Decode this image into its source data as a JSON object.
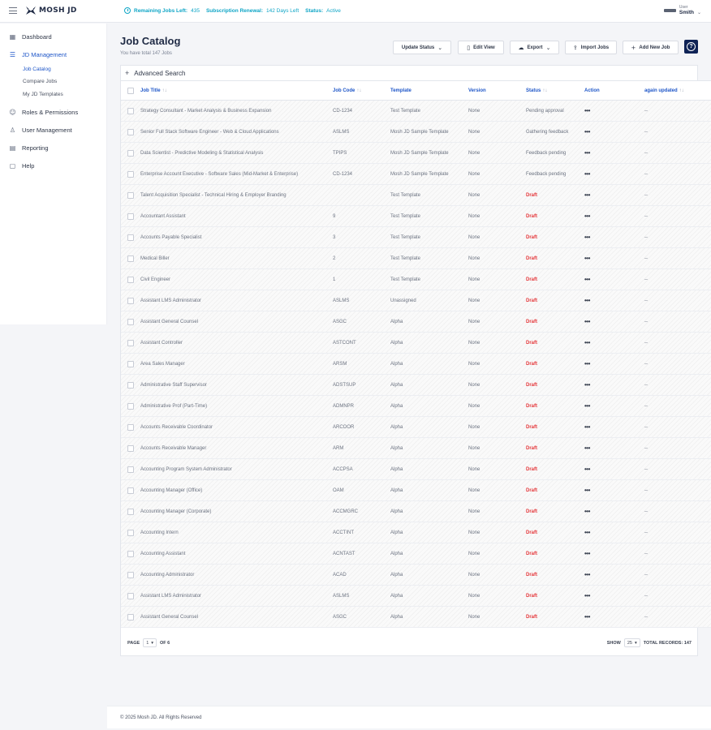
{
  "topbar": {
    "logo_text": "MOSH JD",
    "remaining_label": "Remaining Jobs Left:",
    "remaining_value": "435",
    "renewal_label": "Subscription Renewal:",
    "renewal_value": "142 Days Left",
    "status_label": "Status:",
    "status_value": "Active",
    "user_role": "User",
    "user_name": "Smith"
  },
  "sidebar": {
    "items": [
      {
        "label": "Dashboard",
        "icon": "grid-icon"
      },
      {
        "label": "JD Management",
        "icon": "list-icon"
      },
      {
        "label": "Roles & Permissions",
        "icon": "users-icon"
      },
      {
        "label": "User Management",
        "icon": "user-icon"
      },
      {
        "label": "Reporting",
        "icon": "report-icon"
      },
      {
        "label": "Help",
        "icon": "help-chat-icon"
      }
    ],
    "sub_items": [
      "Job Catalog",
      "Compare Jobs",
      "My JD Templates"
    ]
  },
  "page": {
    "title": "Job Catalog",
    "subtitle": "You have total 147 Jobs"
  },
  "toolbar": {
    "update_status": "Update Status",
    "edit_view": "Edit View",
    "export": "Export",
    "import_jobs": "Import Jobs",
    "add_new_job": "Add New Job"
  },
  "advanced_search": "Advanced Search",
  "table": {
    "headers": {
      "title": "Job Title",
      "code": "Job Code",
      "template": "Template",
      "version": "Version",
      "status": "Status",
      "action": "Action",
      "updated": "again updated"
    },
    "rows": [
      {
        "title": "Strategy Consultant - Market Analysis & Business Expansion",
        "code": "CD-1234",
        "template": "Test Template",
        "version": "None",
        "status": "Pending approval",
        "draft": false,
        "updated": "--"
      },
      {
        "title": "Senior Full Stack Software Engineer - Web & Cloud Applications",
        "code": "ASLMS",
        "template": "Mosh JD Sample Template",
        "version": "None",
        "status": "Gathering feedback",
        "draft": false,
        "updated": "--"
      },
      {
        "title": "Data Scientist - Predictive Modeling & Statistical Analysis",
        "code": "TPIPS",
        "template": "Mosh JD Sample Template",
        "version": "None",
        "status": "Feedback pending",
        "draft": false,
        "updated": "--"
      },
      {
        "title": "Enterprise Account Executive - Software Sales (Mid-Market & Enterprise)",
        "code": "CD-1234",
        "template": "Mosh JD Sample Template",
        "version": "None",
        "status": "Feedback pending",
        "draft": false,
        "updated": "--"
      },
      {
        "title": "Talent Acquisition Specialist - Technical Hiring & Employer Branding",
        "code": "",
        "template": "Test Template",
        "version": "None",
        "status": "Draft",
        "draft": true,
        "updated": "--"
      },
      {
        "title": "Accountant Assistant",
        "code": "9",
        "template": "Test Template",
        "version": "None",
        "status": "Draft",
        "draft": true,
        "updated": "--"
      },
      {
        "title": "Accounts Payable Specialist",
        "code": "3",
        "template": "Test Template",
        "version": "None",
        "status": "Draft",
        "draft": true,
        "updated": "--"
      },
      {
        "title": "Medical Biller",
        "code": "2",
        "template": "Test Template",
        "version": "None",
        "status": "Draft",
        "draft": true,
        "updated": "--"
      },
      {
        "title": "Civil Engineer",
        "code": "1",
        "template": "Test Template",
        "version": "None",
        "status": "Draft",
        "draft": true,
        "updated": "--"
      },
      {
        "title": "Assistant LMS Administrator",
        "code": "ASLMS",
        "template": "Unassigned",
        "version": "None",
        "status": "Draft",
        "draft": true,
        "updated": "--"
      },
      {
        "title": "Assistant General Counsel",
        "code": "ASGC",
        "template": "Alpha",
        "version": "None",
        "status": "Draft",
        "draft": true,
        "updated": "--"
      },
      {
        "title": "Assistant Controller",
        "code": "ASTCONT",
        "template": "Alpha",
        "version": "None",
        "status": "Draft",
        "draft": true,
        "updated": "--"
      },
      {
        "title": "Area Sales Manager",
        "code": "ARSM",
        "template": "Alpha",
        "version": "None",
        "status": "Draft",
        "draft": true,
        "updated": "--"
      },
      {
        "title": "Administrative Staff Supervisor",
        "code": "ADSTSUP",
        "template": "Alpha",
        "version": "None",
        "status": "Draft",
        "draft": true,
        "updated": "--"
      },
      {
        "title": "Administrative Prof (Part-Time)",
        "code": "ADMNPR",
        "template": "Alpha",
        "version": "None",
        "status": "Draft",
        "draft": true,
        "updated": "--"
      },
      {
        "title": "Accounts Receivable Coordinator",
        "code": "ARCOOR",
        "template": "Alpha",
        "version": "None",
        "status": "Draft",
        "draft": true,
        "updated": "--"
      },
      {
        "title": "Accounts Receivable Manager",
        "code": "ARM",
        "template": "Alpha",
        "version": "None",
        "status": "Draft",
        "draft": true,
        "updated": "--"
      },
      {
        "title": "Accounting Program System Administrator",
        "code": "ACCPSA",
        "template": "Alpha",
        "version": "None",
        "status": "Draft",
        "draft": true,
        "updated": "--"
      },
      {
        "title": "Accounting Manager (Office)",
        "code": "OAM",
        "template": "Alpha",
        "version": "None",
        "status": "Draft",
        "draft": true,
        "updated": "--"
      },
      {
        "title": "Accounting Manager (Corporate)",
        "code": "ACCMGRC",
        "template": "Alpha",
        "version": "None",
        "status": "Draft",
        "draft": true,
        "updated": "--"
      },
      {
        "title": "Accounting Intern",
        "code": "ACCTINT",
        "template": "Alpha",
        "version": "None",
        "status": "Draft",
        "draft": true,
        "updated": "--"
      },
      {
        "title": "Accounting Assistant",
        "code": "ACNTAST",
        "template": "Alpha",
        "version": "None",
        "status": "Draft",
        "draft": true,
        "updated": "--"
      },
      {
        "title": "Accounting Administrator",
        "code": "ACAD",
        "template": "Alpha",
        "version": "None",
        "status": "Draft",
        "draft": true,
        "updated": "--"
      },
      {
        "title": "Assistant LMS Administrator",
        "code": "ASLMS",
        "template": "Alpha",
        "version": "None",
        "status": "Draft",
        "draft": true,
        "updated": "--"
      },
      {
        "title": "Assistant General Counsel",
        "code": "ASGC",
        "template": "Alpha",
        "version": "None",
        "status": "Draft",
        "draft": true,
        "updated": "--"
      }
    ]
  },
  "pagination": {
    "page_label": "PAGE",
    "page_value": "1",
    "of_label": "OF 6",
    "show_label": "SHOW",
    "show_value": "25",
    "total_label": "TOTAL RECORDS: 147"
  },
  "footer": "© 2025 Mosh JD. All Rights Reserved",
  "colors": {
    "accent": "#1e56c8",
    "banner": "#0ea5c6",
    "draft": "#e5383b",
    "help_button": "#0f2356"
  }
}
